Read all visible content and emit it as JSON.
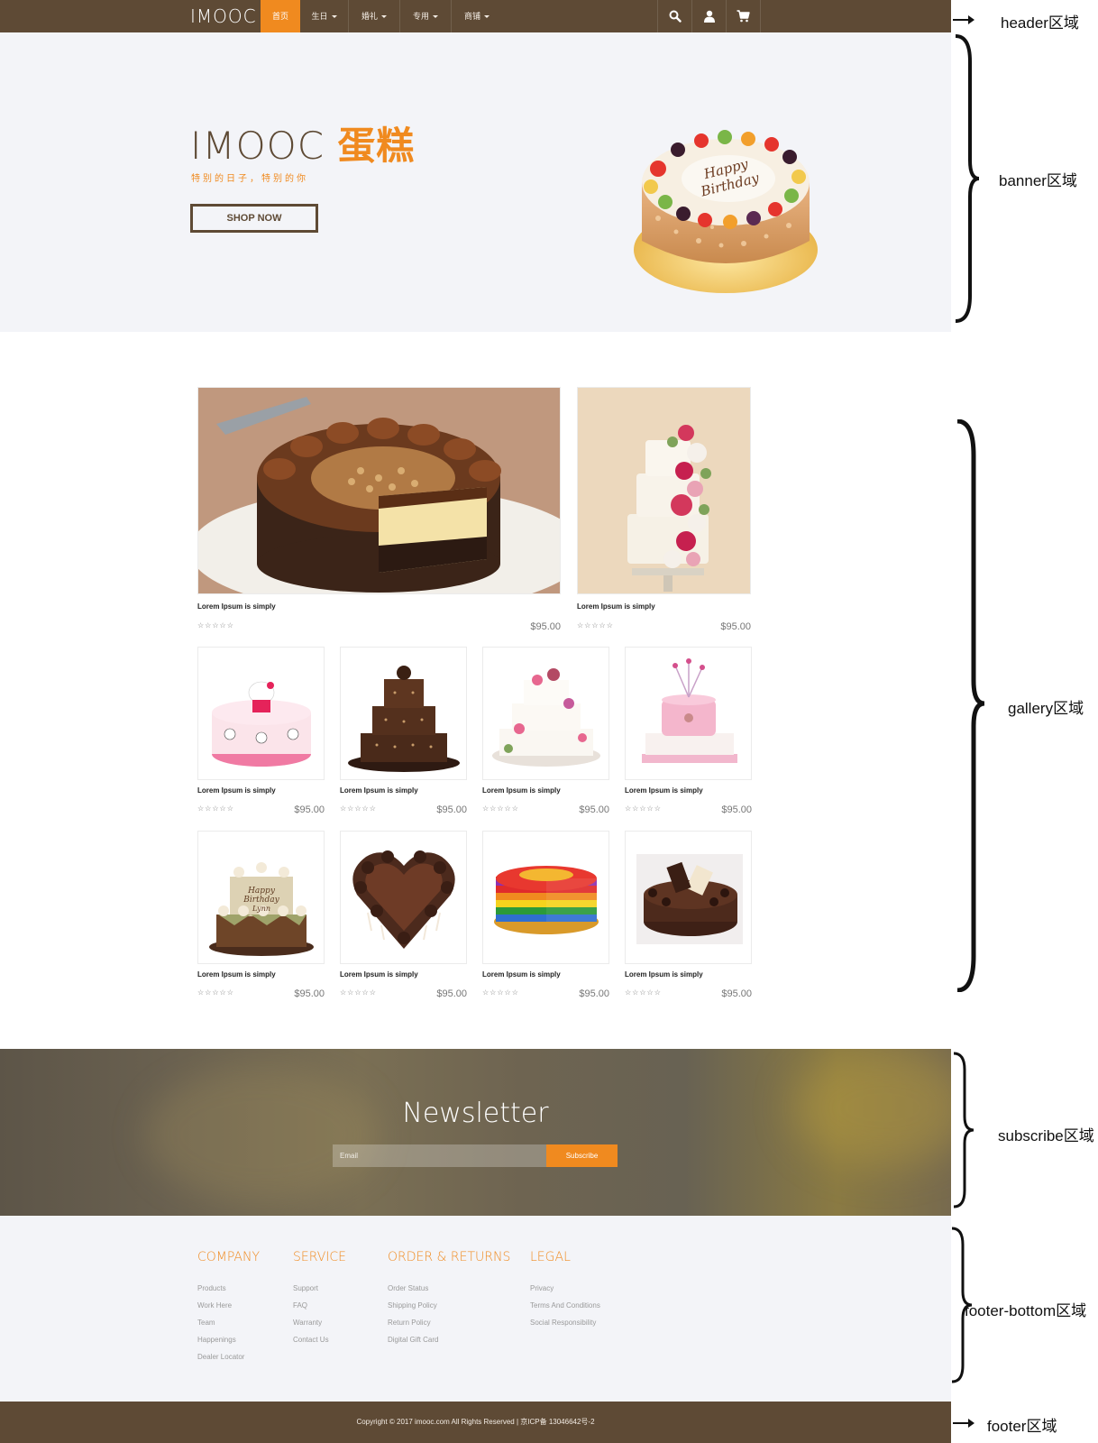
{
  "header": {
    "logo": "IMOOC",
    "nav": [
      {
        "label": "首页",
        "active": true,
        "caret": false
      },
      {
        "label": "生日",
        "active": false,
        "caret": true
      },
      {
        "label": "婚礼",
        "active": false,
        "caret": true
      },
      {
        "label": "专用",
        "active": false,
        "caret": true
      },
      {
        "label": "商铺",
        "active": false,
        "caret": true
      }
    ],
    "icons": [
      "search-icon",
      "user-icon",
      "cart-icon"
    ]
  },
  "banner": {
    "title_main": "IMOOC ",
    "title_accent": "蛋糕",
    "subtitle": "特别的日子，特别的你",
    "cta": "SHOP NOW",
    "cake_text": "Happy Birthday"
  },
  "gallery": {
    "featured": [
      {
        "title": "Lorem Ipsum is simply",
        "rating": "☆☆☆☆☆",
        "price": "$95.00",
        "image": "chocolate-nut-cake"
      },
      {
        "title": "Lorem Ipsum is simply",
        "rating": "☆☆☆☆☆",
        "price": "$95.00",
        "image": "floral-wedding-cake"
      }
    ],
    "row1": [
      {
        "title": "Lorem Ipsum is simply",
        "rating": "☆☆☆☆☆",
        "price": "$95.00",
        "image": "hello-kitty-cake"
      },
      {
        "title": "Lorem Ipsum is simply",
        "rating": "☆☆☆☆☆",
        "price": "$95.00",
        "image": "chocolate-tier-cake"
      },
      {
        "title": "Lorem Ipsum is simply",
        "rating": "☆☆☆☆☆",
        "price": "$95.00",
        "image": "white-tier-flower-cake"
      },
      {
        "title": "Lorem Ipsum is simply",
        "rating": "☆☆☆☆☆",
        "price": "$95.00",
        "image": "pink-star-cake"
      }
    ],
    "row2": [
      {
        "title": "Lorem Ipsum is simply",
        "rating": "☆☆☆☆☆",
        "price": "$95.00",
        "image": "cupcake-tier-cake",
        "cake_text": "Happy Birthday Lynn"
      },
      {
        "title": "Lorem Ipsum is simply",
        "rating": "☆☆☆☆☆",
        "price": "$95.00",
        "image": "heart-chocolate-cake"
      },
      {
        "title": "Lorem Ipsum is simply",
        "rating": "☆☆☆☆☆",
        "price": "$95.00",
        "image": "rainbow-cake"
      },
      {
        "title": "Lorem Ipsum is simply",
        "rating": "☆☆☆☆☆",
        "price": "$95.00",
        "image": "chocolate-truffle-cake"
      }
    ]
  },
  "subscribe": {
    "title": "Newsletter",
    "placeholder": "Email",
    "button": "Subscribe"
  },
  "footer_bottom": {
    "columns": [
      {
        "heading": "COMPANY",
        "links": [
          "Products",
          "Work Here",
          "Team",
          "Happenings",
          "Dealer Locator"
        ]
      },
      {
        "heading": "SERVICE",
        "links": [
          "Support",
          "FAQ",
          "Warranty",
          "Contact Us"
        ]
      },
      {
        "heading": "ORDER & RETURNS",
        "links": [
          "Order Status",
          "Shipping Policy",
          "Return Policy",
          "Digital Gift Card"
        ]
      },
      {
        "heading": "LEGAL",
        "links": [
          "Privacy",
          "Terms And Conditions",
          "Social Responsibility"
        ]
      }
    ]
  },
  "footer": {
    "copyright": "Copyright © 2017 imooc.com All Rights Reserved | 京ICP备 13046642号-2"
  },
  "annotations": {
    "header": "header区域",
    "banner": "banner区域",
    "gallery": "gallery区域",
    "subscribe": "subscribe区域",
    "footer_bottom": "footer-bottom区域",
    "footer": "footer区域"
  },
  "colors": {
    "brand_brown": "#5e4a35",
    "accent_orange": "#f08a1f",
    "banner_bg": "#f3f4f8"
  }
}
